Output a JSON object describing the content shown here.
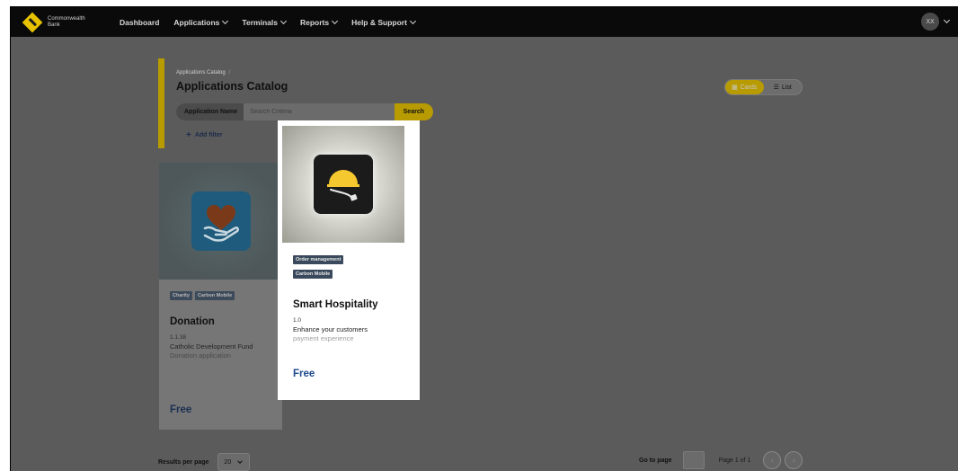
{
  "brand": {
    "name_line1": "Commonwealth",
    "name_line2": "Bank"
  },
  "nav": {
    "items": [
      {
        "label": "Dashboard",
        "has_menu": false
      },
      {
        "label": "Applications",
        "has_menu": true
      },
      {
        "label": "Terminals",
        "has_menu": true
      },
      {
        "label": "Reports",
        "has_menu": true
      },
      {
        "label": "Help & Support",
        "has_menu": true
      }
    ]
  },
  "user": {
    "initials": "XX"
  },
  "breadcrumb": {
    "current": "Applications Catalog",
    "separator": "/"
  },
  "page_title": "Applications Catalog",
  "search": {
    "label": "Application Name",
    "placeholder": "Search Criteria",
    "button": "Search"
  },
  "add_filter": {
    "label": "Add filter"
  },
  "view_toggle": {
    "cards": "Cards",
    "list": "List",
    "selected": "Cards"
  },
  "apps": [
    {
      "tags": [
        "Charity",
        "Carbon Mobile"
      ],
      "title": "Donation",
      "version": "1.1.38",
      "description": "Catholic Development Fund",
      "description2": "Donation application",
      "price": "Free",
      "icon": "heart-in-hand-icon"
    },
    {
      "tags": [
        "Order management",
        "Carbon Mobile"
      ],
      "title": "Smart Hospitality",
      "version": "1.0",
      "description": "Enhance your customers",
      "description2": "payment experience",
      "price": "Free",
      "icon": "cloche-service-icon"
    }
  ],
  "footer": {
    "results_label": "Results per page",
    "per_page": "20",
    "goto_label": "Go to page",
    "page_info": "Page 1 of 1"
  },
  "colors": {
    "accent": "#b89b00",
    "nav_bg": "#0a0a0a",
    "overlay": "#5b5b5b"
  }
}
